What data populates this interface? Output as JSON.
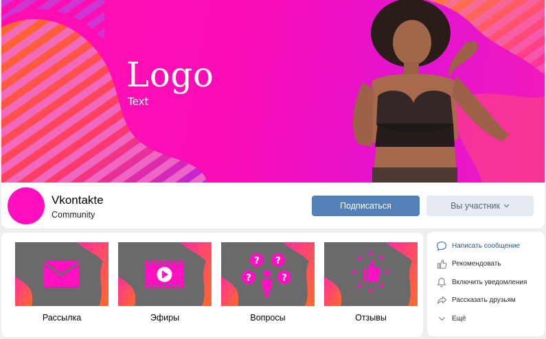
{
  "cover": {
    "logo": "Logo",
    "logo_sub": "Text"
  },
  "profile": {
    "name": "Vkontakte",
    "subtitle": "Community",
    "subscribe_label": "Подписаться",
    "member_label": "Вы участник",
    "avatar_color": "#ff0fbe"
  },
  "menu": {
    "items": [
      {
        "label": "Рассылка",
        "icon": "envelope-icon"
      },
      {
        "label": "Эфиры",
        "icon": "video-play-icon"
      },
      {
        "label": "Вопросы",
        "icon": "questions-icon"
      },
      {
        "label": "Отзывы",
        "icon": "thumbs-up-stars-icon"
      }
    ]
  },
  "actions": {
    "items": [
      {
        "label": "Написать сообщение",
        "icon": "message-icon"
      },
      {
        "label": "Рекомендовать",
        "icon": "like-icon"
      },
      {
        "label": "Включить уведомления",
        "icon": "bell-icon"
      },
      {
        "label": "Рассказать друзьям",
        "icon": "share-icon"
      },
      {
        "label": "Ещё",
        "icon": "chevron-down-icon"
      }
    ]
  },
  "colors": {
    "accent": "#ff0fbe",
    "button_primary": "#5181b8",
    "button_secondary": "#e5ebf1",
    "tile_gray": "#6a6a6a",
    "link": "#2a5885"
  }
}
